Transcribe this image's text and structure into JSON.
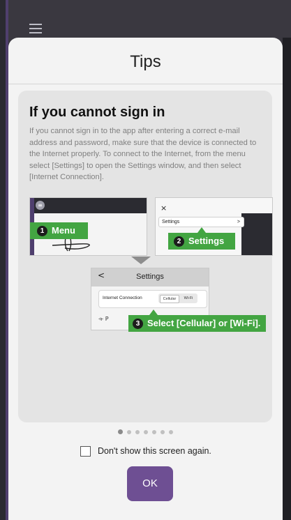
{
  "modal": {
    "title": "Tips"
  },
  "tip": {
    "heading": "If you cannot sign in",
    "body": "If you cannot sign in to the app after entering a correct e-mail address and password, make sure that the device is connected to the Internet properly. To connect to the Internet, from the menu select [Settings] to open the Settings window, and then select [Internet Connection]."
  },
  "illustration": {
    "step1": {
      "num": "1",
      "label": "Menu"
    },
    "step2": {
      "num": "2",
      "label": "Settings"
    },
    "step3": {
      "num": "3",
      "label": "Select [Cellular] or [Wi-Fi]."
    },
    "menu_row": "Settings",
    "menu_row_chev": ">",
    "close": "×",
    "back": "<",
    "settings_title": "Settings",
    "internet_connection": "Internet Connection",
    "option_cellular": "Cellular",
    "option_wifi": "Wi-Fi"
  },
  "pager": {
    "total": 7,
    "current": 1
  },
  "checkbox": {
    "label": "Don't show this screen again.",
    "checked": false
  },
  "ok_label": "OK",
  "colors": {
    "accent": "#6e4f93",
    "green": "#43a542",
    "sidebar": "#4f3f6e"
  },
  "icons": {
    "menu": "hamburger-icon"
  }
}
